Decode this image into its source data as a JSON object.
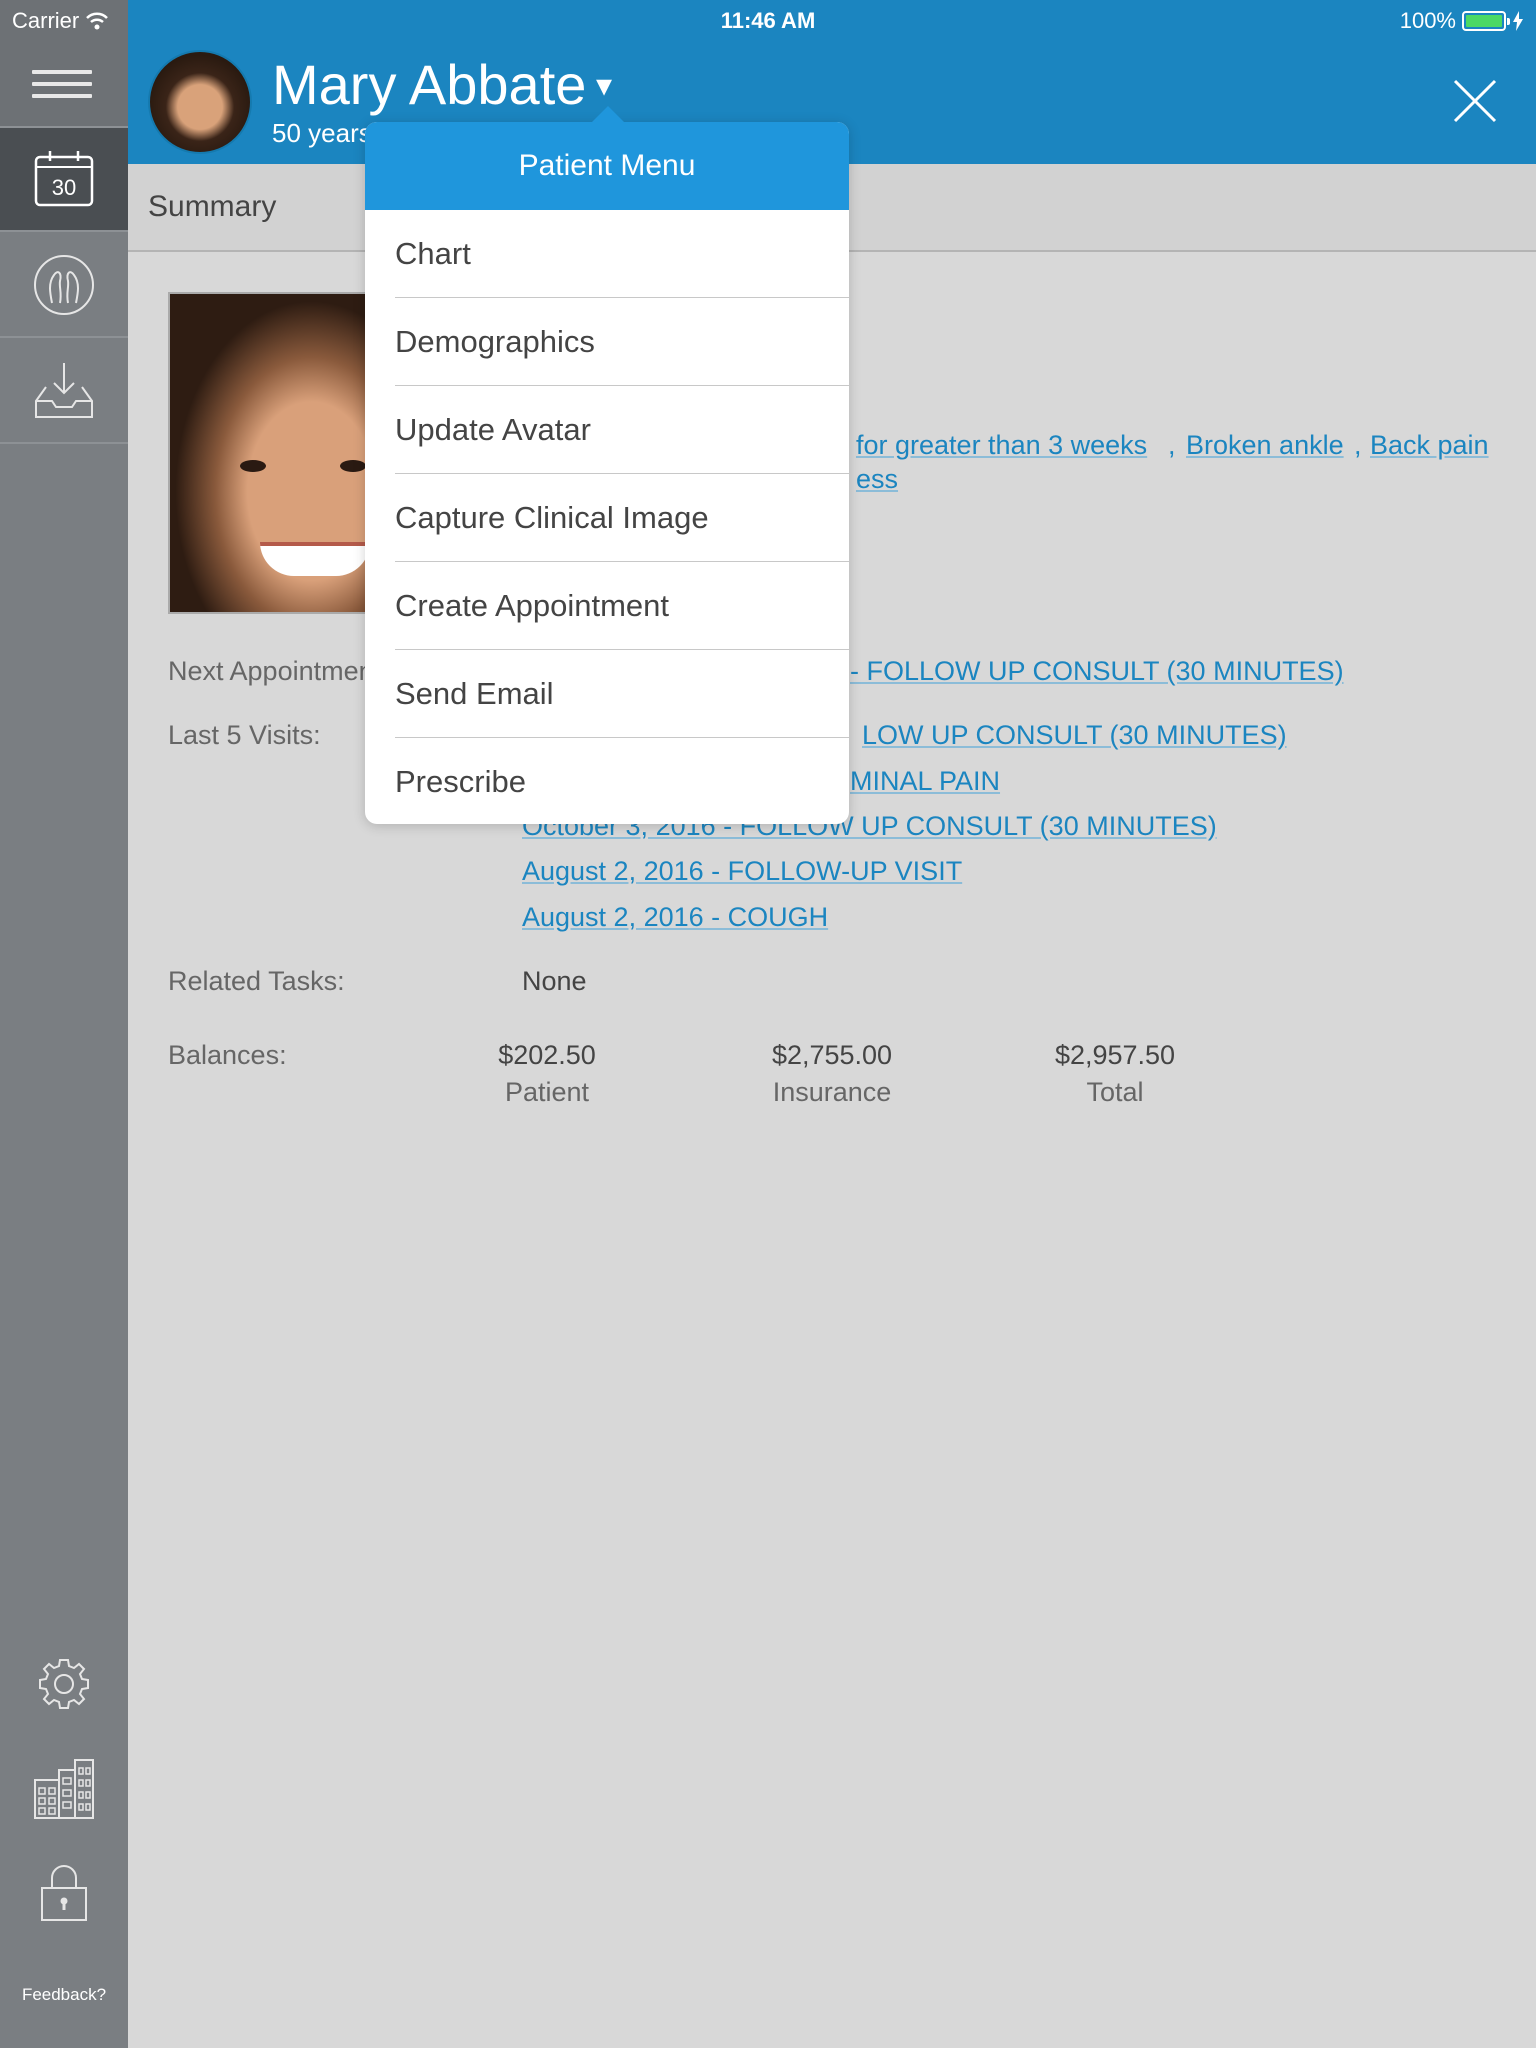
{
  "status_bar": {
    "carrier": "Carrier",
    "time": "11:46 AM",
    "battery": "100%"
  },
  "sidebar": {
    "items": [
      {
        "name": "calendar",
        "icon": "calendar-icon",
        "label": "30",
        "active": true
      },
      {
        "name": "patients",
        "icon": "patients-icon",
        "active": false
      },
      {
        "name": "inbox",
        "icon": "inbox-download-icon",
        "active": false
      }
    ],
    "bottom_items": [
      {
        "name": "settings",
        "icon": "gear-icon"
      },
      {
        "name": "practice",
        "icon": "buildings-icon"
      },
      {
        "name": "lock",
        "icon": "lock-icon"
      }
    ],
    "feedback_label": "Feedback?"
  },
  "header": {
    "patient_name": "Mary Abbate",
    "patient_age": "50 years",
    "caret": "▾",
    "close_icon": "close-icon"
  },
  "tabs": {
    "active": "Summary"
  },
  "summary": {
    "problems_partial": [
      "for greater than 3 weeks",
      "Broken ankle",
      "Back pain"
    ],
    "problems_partial_line2": "ess",
    "next_appointment_label": "Next Appointment:",
    "next_appointment_visible": "- FOLLOW UP CONSULT (30 MINUTES)",
    "last_visits_label": "Last 5 Visits:",
    "last_visits": [
      "LOW UP CONSULT (30 MINUTES)",
      "MINAL PAIN",
      "October 3, 2016 - FOLLOW UP CONSULT (30 MINUTES)",
      "August 2, 2016 - FOLLOW-UP VISIT",
      "August 2, 2016 - COUGH"
    ],
    "related_tasks_label": "Related Tasks:",
    "related_tasks_value": "None",
    "balances_label": "Balances:",
    "balances": [
      {
        "amount": "$202.50",
        "label": "Patient"
      },
      {
        "amount": "$2,755.00",
        "label": "Insurance"
      },
      {
        "amount": "$2,957.50",
        "label": "Total"
      }
    ]
  },
  "patient_menu": {
    "title": "Patient Menu",
    "items": [
      "Chart",
      "Demographics",
      "Update Avatar",
      "Capture Clinical Image",
      "Create Appointment",
      "Send Email",
      "Prescribe"
    ]
  },
  "colors": {
    "header_blue": "#1b85c0",
    "menu_title_blue": "#1f96dc",
    "link_blue": "#1b85c0",
    "sidebar_gray": "#7a7e82"
  }
}
